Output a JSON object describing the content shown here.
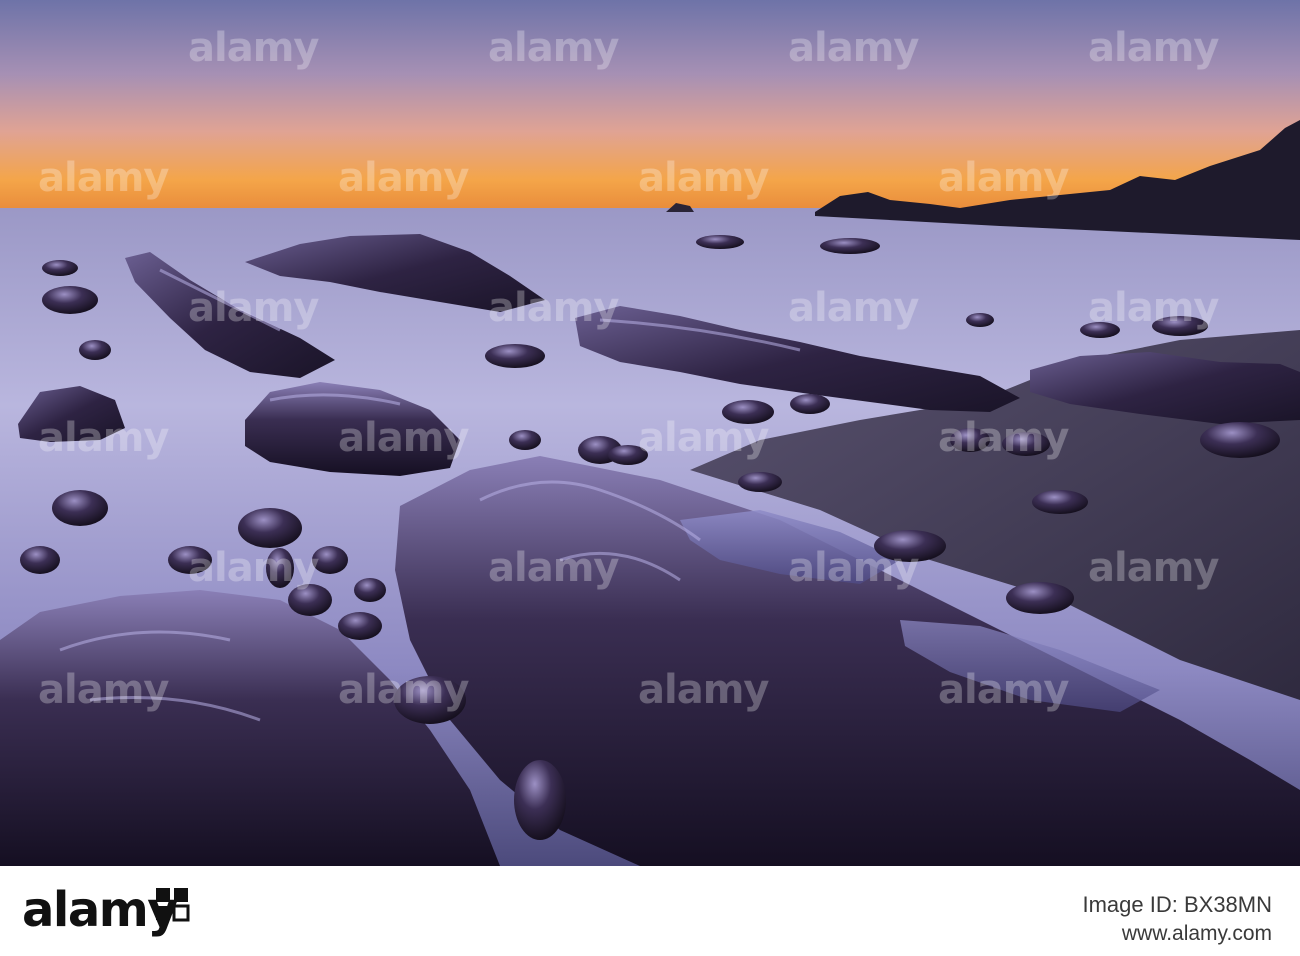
{
  "scene": {
    "description_colors": {
      "sky_top": "#8e86b8",
      "sky_mid": "#c79aa5",
      "horizon_glow": "#f2a24a",
      "sea_mist": "#b6b3dc",
      "rock_dark": "#2a1f3a",
      "rock_highlight": "#7c6fa8",
      "beach": "#4a4258"
    }
  },
  "watermark": {
    "text": "alamy",
    "icon": "alamy-logo-icon"
  },
  "footer": {
    "brand": "alamy",
    "brand_icon": "alamy-logo-icon",
    "image_id": "Image ID: BX38MN",
    "url": "www.alamy.com"
  }
}
